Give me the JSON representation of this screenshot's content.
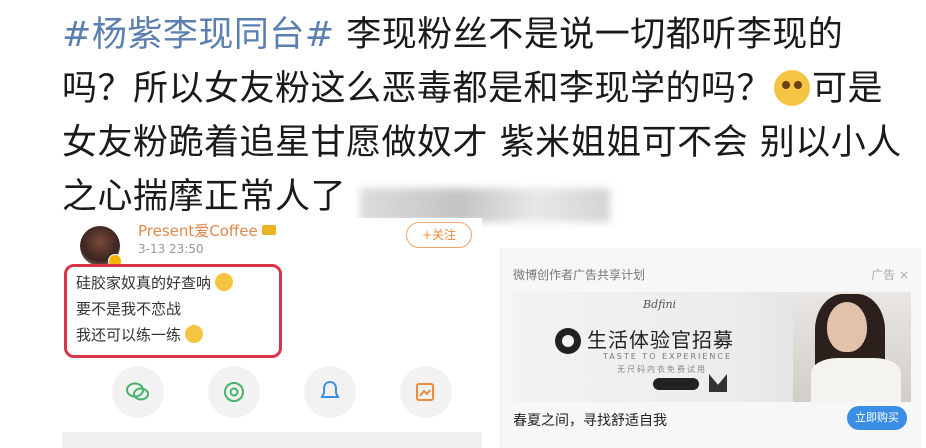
{
  "post": {
    "hashtag": "#杨紫李现同台#",
    "text_part1": "李现粉丝不是说一切都听李现的吗？所以女友粉这么恶毒都是和李现学的吗？",
    "emoji_1": "frightened-face-emoji",
    "text_part2": "可是女友粉跪着追星甘愿做奴才 紫米姐姐可不会 别以小人之心揣摩正常人了"
  },
  "left_card": {
    "username": "Present爱Coffee",
    "time": "3-13 23:50",
    "follow_label": "+关注",
    "quote_lines": [
      "硅胶家奴真的好查呐",
      "要不是我不恋战",
      "我还可以练一练"
    ],
    "share_icons": [
      "wechat-icon",
      "moments-icon",
      "qq-icon",
      "share-image-icon"
    ]
  },
  "ad_card": {
    "header": "微博创作者广告共享计划",
    "ad_tag": "广告 ×",
    "brand_small": "Bdfini",
    "banner_title": "生活体验官招募",
    "banner_sub": "TASTE TO EXPERIENCE",
    "banner_sub2": "无尺码内衣免费试用",
    "caption": "春夏之间，寻找舒适自我",
    "buy_label": "立即购买"
  },
  "colors": {
    "hashtag": "#5b7fb0",
    "highlight_border": "#d9344a",
    "follow": "#f08a3c",
    "buy_button": "#3a8ee6"
  }
}
